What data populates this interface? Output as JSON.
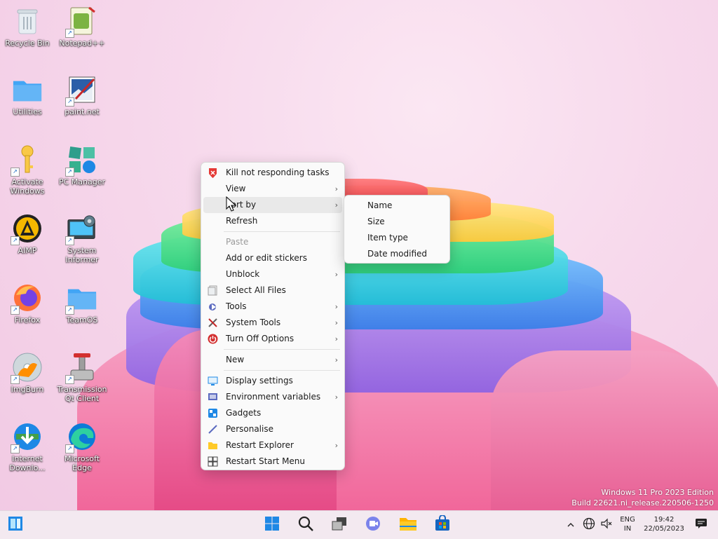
{
  "desktop_icons": [
    {
      "id": "recycle-bin",
      "label": "Recycle Bin",
      "icon": "recycle-bin-icon",
      "shortcut": false
    },
    {
      "id": "notepad",
      "label": "Notepad++",
      "icon": "notepad-icon",
      "shortcut": true
    },
    {
      "id": "utilities",
      "label": "Utilities",
      "icon": "folder-icon",
      "shortcut": false
    },
    {
      "id": "paintnet",
      "label": "paint.net",
      "icon": "paintnet-icon",
      "shortcut": true
    },
    {
      "id": "activate",
      "label": "Activate Windows",
      "icon": "key-icon",
      "shortcut": true
    },
    {
      "id": "pc-manager",
      "label": "PC Manager",
      "icon": "pc-manager-icon",
      "shortcut": true
    },
    {
      "id": "aimp",
      "label": "AIMP",
      "icon": "aimp-icon",
      "shortcut": true
    },
    {
      "id": "system-informer",
      "label": "System Informer",
      "icon": "system-informer-icon",
      "shortcut": true
    },
    {
      "id": "firefox",
      "label": "Firefox",
      "icon": "firefox-icon",
      "shortcut": true
    },
    {
      "id": "teamos",
      "label": "TeamOS",
      "icon": "folder-icon",
      "shortcut": true
    },
    {
      "id": "imgburn",
      "label": "ImgBurn",
      "icon": "imgburn-icon",
      "shortcut": true
    },
    {
      "id": "transmission",
      "label": "Transmission Qt Client",
      "icon": "transmission-icon",
      "shortcut": true
    },
    {
      "id": "idm",
      "label": "Internet Downlo...",
      "icon": "idm-icon",
      "shortcut": true
    },
    {
      "id": "edge",
      "label": "Microsoft Edge",
      "icon": "edge-icon",
      "shortcut": true
    }
  ],
  "context_menu": {
    "items": [
      {
        "label": "Kill not responding tasks",
        "icon": "kill-tasks-icon",
        "submenu": false
      },
      {
        "label": "View",
        "submenu": true
      },
      {
        "label": "Sort by",
        "submenu": true,
        "active": true
      },
      {
        "label": "Refresh",
        "submenu": false
      },
      {
        "label": "Paste",
        "disabled": true
      },
      {
        "label": "Add or edit stickers",
        "submenu": false
      },
      {
        "label": "Unblock",
        "submenu": true
      },
      {
        "label": "Select All Files",
        "icon": "select-all-icon",
        "submenu": false
      },
      {
        "label": "Tools",
        "icon": "tools-icon",
        "submenu": true
      },
      {
        "label": "System Tools",
        "icon": "system-tools-icon",
        "submenu": true
      },
      {
        "label": "Turn Off Options",
        "icon": "power-icon",
        "submenu": true
      },
      {
        "label": "New",
        "submenu": true
      },
      {
        "label": "Display settings",
        "icon": "display-icon",
        "submenu": false
      },
      {
        "label": "Environment variables",
        "icon": "env-vars-icon",
        "submenu": true
      },
      {
        "label": "Gadgets",
        "icon": "gadgets-icon",
        "submenu": false
      },
      {
        "label": "Personalise",
        "icon": "personalise-icon",
        "submenu": false
      },
      {
        "label": "Restart Explorer",
        "icon": "explorer-folder-icon",
        "submenu": true
      },
      {
        "label": "Restart Start Menu",
        "icon": "start-menu-icon",
        "submenu": false
      }
    ],
    "arrow": "›"
  },
  "sort_submenu": {
    "items": [
      "Name",
      "Size",
      "Item type",
      "Date modified"
    ]
  },
  "watermark": {
    "line1": "Windows 11 Pro 2023 Edition",
    "line2": "Build 22621.ni_release.220506-1250"
  },
  "taskbar": {
    "tray": {
      "lang_top": "ENG",
      "lang_bottom": "IN",
      "time": "19:42",
      "date": "22/05/2023"
    }
  },
  "colors": {
    "windows_blue": "#1e88e5",
    "menu_bg": "#fafafa"
  }
}
